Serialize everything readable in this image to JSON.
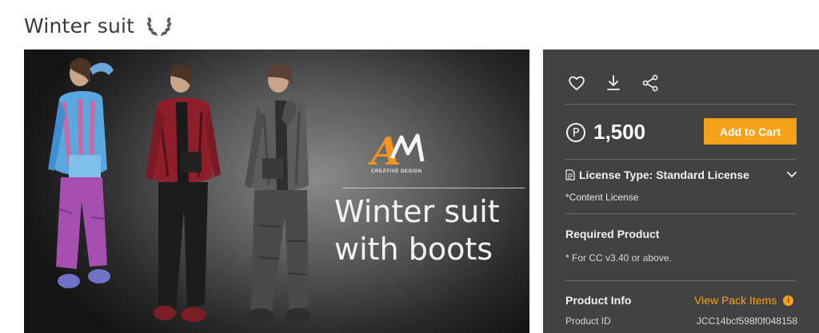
{
  "product": {
    "title": "Winter suit",
    "badge_icon": "laurel-wreath-icon"
  },
  "hero": {
    "line1": "Winter suit",
    "line2": "with boots",
    "brand_letters": "AM",
    "brand_subtitle": "CREATIVE DESIGN",
    "brand_color": "#f7941d"
  },
  "actions": {
    "icons": [
      "heart-icon",
      "download-icon",
      "share-icon"
    ]
  },
  "pricing": {
    "currency_symbol": "P",
    "price": "1,500",
    "add_to_cart_label": "Add to Cart",
    "accent_color": "#f5a21b"
  },
  "license": {
    "type_label": "License Type: Standard License",
    "note": "*Content License"
  },
  "required": {
    "title": "Required Product",
    "note": "* For CC v3.40 or above."
  },
  "product_info": {
    "title": "Product Info",
    "view_pack_label": "View Pack Items",
    "id_label": "Product ID",
    "id_value": "JCC14bcf598f0f048158"
  }
}
